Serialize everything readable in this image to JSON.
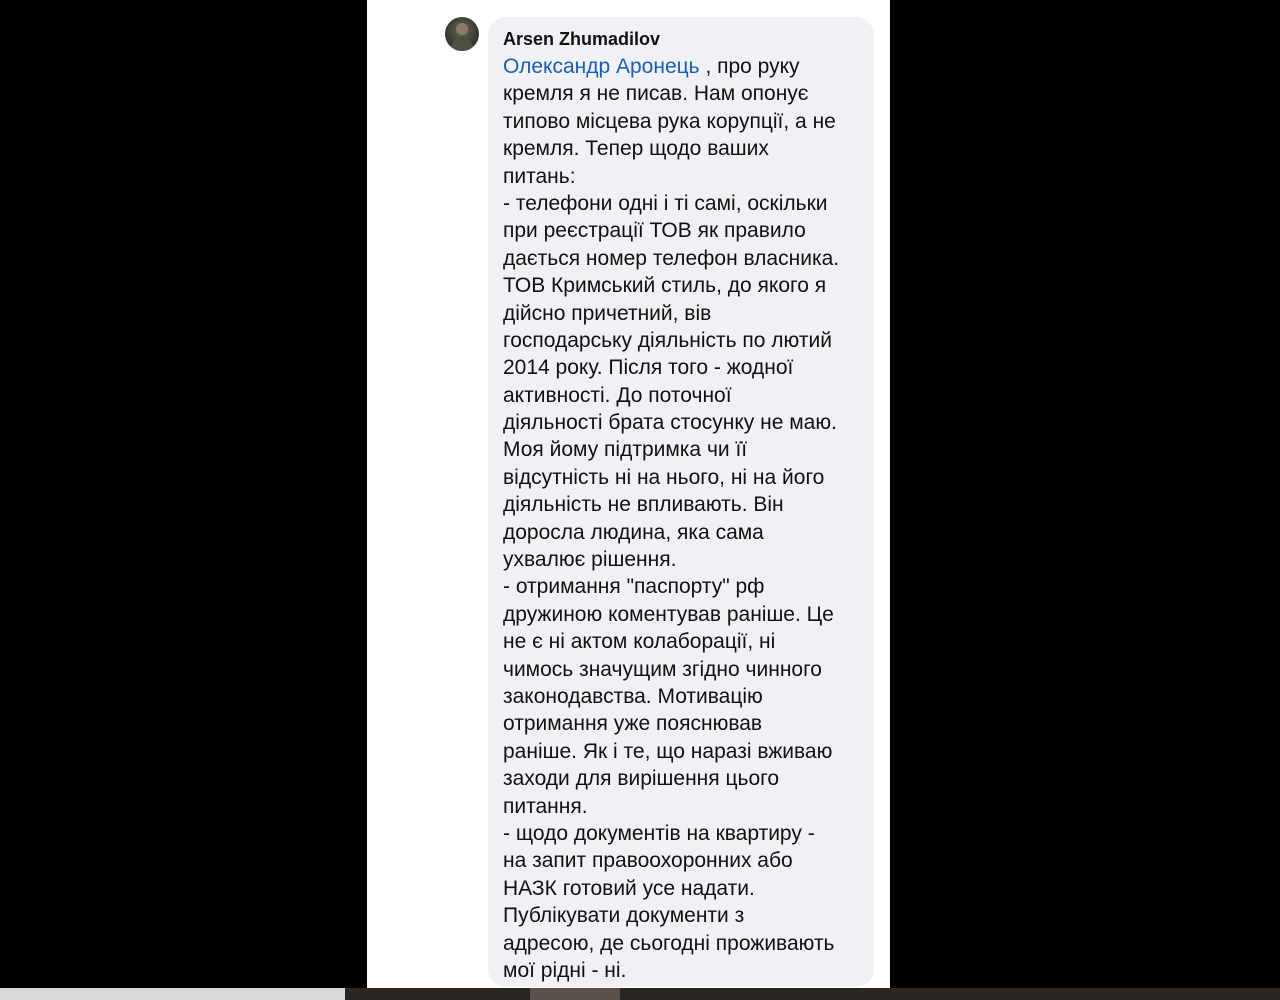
{
  "comment": {
    "author": "Arsen Zhumadilov",
    "mention": "Олександр Аронець",
    "first_line_rest": " , про руку",
    "lines": [
      "кремля я не писав. Нам опонує",
      "типово місцева рука корупції, а не",
      "кремля. Тепер щодо ваших",
      "питань:",
      "- телефони одні і ті самі, оскільки",
      "при реєстрації ТОВ як правило",
      "дається номер телефон власника.",
      "ТОВ Кримський стиль, до якого я",
      "дійсно причетний, вів",
      "господарську діяльність по лютий",
      "2014 року. Після того - жодної",
      "активності. До поточної",
      "діяльності брата стосунку не маю.",
      "Моя йому підтримка чи її",
      "відсутність ні на нього, ні на його",
      "діяльність не впливають. Він",
      "доросла людина, яка сама",
      "ухвалює рішення.",
      "- отримання \"паспорту\" рф",
      "дружиною коментував раніше. Це",
      "не є ні актом колаборації, ні",
      "чимось значущим згідно чинного",
      "законодавства. Мотивацію",
      "отримання уже пояснював",
      "раніше. Як і те, що наразі вживаю",
      "заходи для вирішення цього",
      "питання.",
      "- щодо документів на квартиру -",
      "на запит правоохоронних або",
      "НАЗК готовий усе надати.",
      "Публікувати документи з",
      "адресою, де сьогодні проживають",
      "мої рідні - ні."
    ]
  },
  "colors": {
    "bubble_bg": "#eff1f4",
    "mention": "#1a5fb0",
    "text": "#111111",
    "backdrop": "#000000"
  }
}
